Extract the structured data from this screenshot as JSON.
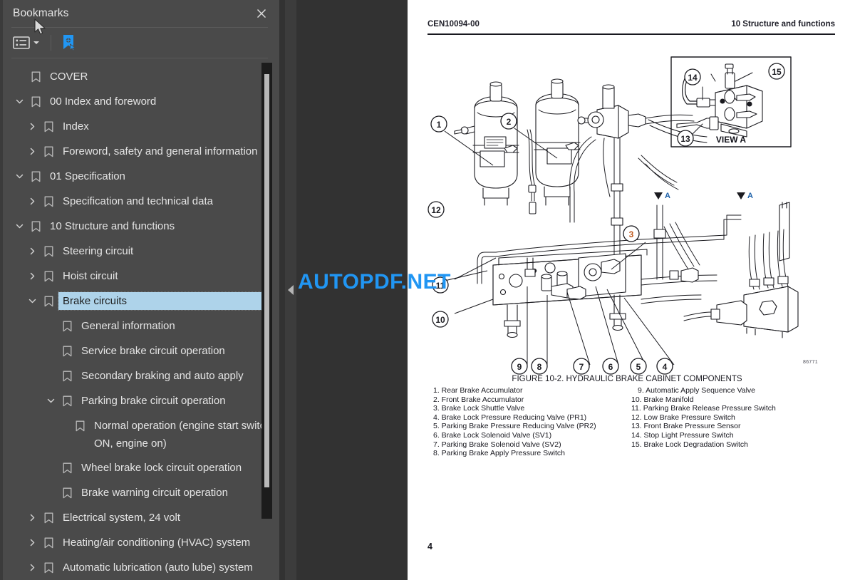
{
  "sidebar": {
    "title": "Bookmarks",
    "close_icon": "close-icon",
    "toolbar": {
      "options_icon": "list-options-icon",
      "caret_icon": "chevron-down-icon",
      "new_bookmark_icon": "new-bookmark-icon"
    },
    "items": [
      {
        "label": "COVER",
        "level": 0,
        "twisty": "none",
        "selected": false
      },
      {
        "label": "00 Index and foreword",
        "level": 0,
        "twisty": "expanded",
        "selected": false
      },
      {
        "label": "Index",
        "level": 1,
        "twisty": "collapsed",
        "selected": false
      },
      {
        "label": "Foreword, safety and general information",
        "level": 1,
        "twisty": "collapsed",
        "selected": false
      },
      {
        "label": "01 Specification",
        "level": 0,
        "twisty": "expanded",
        "selected": false
      },
      {
        "label": "Specification and technical data",
        "level": 1,
        "twisty": "collapsed",
        "selected": false
      },
      {
        "label": "10 Structure and functions",
        "level": 0,
        "twisty": "expanded",
        "selected": false
      },
      {
        "label": "Steering circuit",
        "level": 1,
        "twisty": "collapsed",
        "selected": false
      },
      {
        "label": "Hoist circuit",
        "level": 1,
        "twisty": "collapsed",
        "selected": false
      },
      {
        "label": "Brake circuits",
        "level": 1,
        "twisty": "expanded",
        "selected": true
      },
      {
        "label": "General information",
        "level": 2,
        "twisty": "none",
        "selected": false
      },
      {
        "label": "Service brake circuit operation",
        "level": 2,
        "twisty": "none",
        "selected": false
      },
      {
        "label": "Secondary braking and auto apply",
        "level": 2,
        "twisty": "none",
        "selected": false
      },
      {
        "label": "Parking brake circuit operation",
        "level": 2,
        "twisty": "expanded",
        "selected": false
      },
      {
        "label": "Normal operation (engine start switch ON, engine on)",
        "level": 3,
        "twisty": "none",
        "selected": false
      },
      {
        "label": "Wheel brake lock circuit operation",
        "level": 2,
        "twisty": "none",
        "selected": false
      },
      {
        "label": "Brake warning circuit operation",
        "level": 2,
        "twisty": "none",
        "selected": false
      },
      {
        "label": "Electrical system, 24 volt",
        "level": 1,
        "twisty": "collapsed",
        "selected": false
      },
      {
        "label": "Heating/air conditioning (HVAC) system",
        "level": 1,
        "twisty": "collapsed",
        "selected": false
      },
      {
        "label": "Automatic lubrication (auto lube) system",
        "level": 1,
        "twisty": "collapsed",
        "selected": false
      }
    ],
    "selected_color": "#aed3ea"
  },
  "gutter": {
    "collapse_icon": "collapse-left-arrow-icon"
  },
  "document": {
    "header_left": "CEN10094-00",
    "header_right": "10 Structure and functions",
    "figure_caption": "FIGURE 10-2. HYDRAULIC BRAKE CABINET COMPONENTS",
    "figure_id": "86771",
    "view_label": "VIEW A",
    "section_marker": "A",
    "page_number": "4",
    "callouts": [
      "1",
      "2",
      "3",
      "4",
      "5",
      "6",
      "7",
      "8",
      "9",
      "10",
      "11",
      "12",
      "13",
      "14",
      "15"
    ],
    "legend_left": [
      "1. Rear Brake Accumulator",
      "2. Front Brake Accumulator",
      "3. Brake Lock Shuttle Valve",
      "4. Brake Lock Pressure Reducing Valve (PR1)",
      "5. Parking Brake Pressure Reducing Valve (PR2)",
      "6. Brake Lock Solenoid Valve (SV1)",
      "7. Parking Brake Solenoid Valve (SV2)",
      "8. Parking Brake Apply Pressure Switch"
    ],
    "legend_right": [
      "9. Automatic Apply Sequence Valve",
      "10. Brake Manifold",
      "11. Parking Brake Release Pressure Switch",
      "12. Low Brake Pressure Switch",
      "13. Front Brake Pressure Sensor",
      "14. Stop Light Pressure Switch",
      "15. Brake Lock Degradation Switch"
    ]
  },
  "watermark": {
    "text": "AUTOPDF.NET",
    "color": "#2196f3"
  }
}
